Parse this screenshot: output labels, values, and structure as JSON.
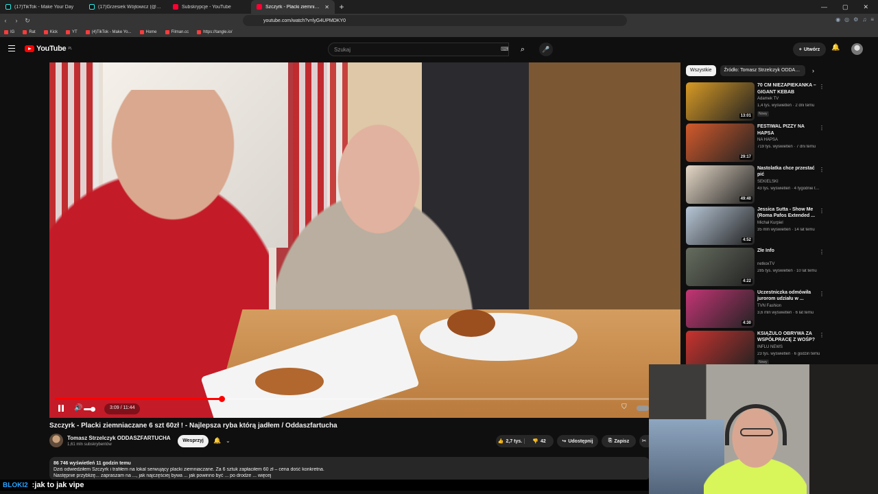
{
  "browser": {
    "tabs": [
      {
        "label": "(17)TikTok - Make Your Day",
        "icon": "tiktok-icon",
        "active": false
      },
      {
        "label": "(17)Grzesiek Wójtowicz (@grzesiek...",
        "icon": "tiktok-icon",
        "active": false
      },
      {
        "label": "Subskrypcje - YouTube",
        "icon": "youtube-icon",
        "active": false
      },
      {
        "label": "Szczyrk - Placki ziemniaczane...",
        "icon": "youtube-icon",
        "active": true
      }
    ],
    "url": "youtube.com/watch?v=lyG4UPMDKY0",
    "bookmarks": [
      "IG",
      "Rat",
      "Kick",
      "YT",
      "(4)TikTok - Make Yo...",
      "Home",
      "Filman.cc",
      "https://tangle.io/"
    ]
  },
  "youtube": {
    "logo_text": "YouTube",
    "region": "PL",
    "search_placeholder": "Szukaj",
    "create_label": "Utwórz"
  },
  "player": {
    "time": "3:09 / 11:44",
    "progress": 0.269
  },
  "video": {
    "title": "Szczyrk - Placki ziemniaczane 6 szt 60zł ! - Najlepsza ryba którą jadłem / Oddaszfartucha",
    "channel": "Tomasz Strzelczyk ODDASZFARTUCHA",
    "subscribers": "1,61 mln subskrybentów",
    "support_label": "Wesprzyj",
    "likes": "2,7 tys.",
    "dislikes": "42",
    "share_label": "Udostępnij",
    "save_label": "Zapisz",
    "stats": "86 746 wyświetleń  11 godzin temu",
    "description": "Dziś odwiedziłem Szczyrk i trafiłem na lokal serwujący placki ziemniaczane. Za 6 sztuk zapłaciłem 60 zł – cena dość konkretna.",
    "description_2": "Następnie przybliżę... zapraszam na ..., jak najczęściej bywa ... jak powinno być ... po drodze ... więcej"
  },
  "sidebar": {
    "chips": [
      "Wszystkie",
      "Źródło: Tomasz Strzelczyk ODDASZFARTUCHA"
    ],
    "recommendations": [
      {
        "title": "70 CM NIEZAPIEKANKA – GIGANT KEBAB Czeburek",
        "channel": "Adamek TV",
        "meta": "1,4 tys. wyświetleń · 2 dni temu",
        "badge": "Nowy",
        "duration": "13:01",
        "color": "#d89a24"
      },
      {
        "title": "FESTIWAL PIZZY NA HAPSA",
        "channel": "NA HAPSA",
        "meta": "719 tys. wyświetleń · 7 dni temu",
        "badge": "",
        "duration": "29:17",
        "color": "#d35a2c"
      },
      {
        "title": "Nastolatka chce przestać pić",
        "channel": "SEKIELSKI",
        "meta": "43 tys. wyświetleń · 4 tygodnie temu",
        "badge": "",
        "duration": "49:40",
        "color": "#e5d8c7"
      },
      {
        "title": "Jessica Sutta - Show Me (Roma Pafos Extended ...",
        "channel": "Michał Kurpiel",
        "meta": "35 mln wyświetleń · 14 lat temu",
        "badge": "",
        "duration": "4:52",
        "color": "#b7c6d6"
      },
      {
        "title": "Złe Info",
        "channel": "netkoxTV",
        "meta": "285 tys. wyświetleń · 10 lat temu",
        "badge": "",
        "duration": "4:22",
        "color": "#666d5f"
      },
      {
        "title": "Uczestniczka odmówiła jurorom udziału w ...",
        "channel": "TVN Fashion",
        "meta": "3,6 mln wyświetleń · 6 lat temu",
        "badge": "",
        "duration": "4:30",
        "color": "#c33575"
      },
      {
        "title": "KSIĄŻULO OBRYWA ZA WSPÓŁPRACĘ Z WOŚP? ...",
        "channel": "INFLU NEWS",
        "meta": "23 tys. wyświetleń · 6 godzin temu",
        "badge": "Nowy",
        "duration": "",
        "color": "#c9332f"
      }
    ]
  },
  "overlay": {
    "chat_user": "BLOKI2",
    "chat_message": ":jak to jak vipe"
  }
}
